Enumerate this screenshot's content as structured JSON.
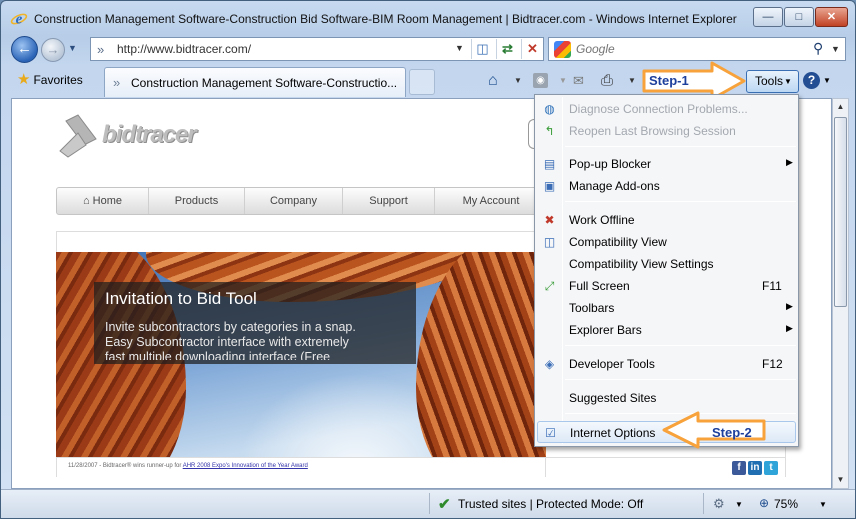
{
  "window": {
    "title": "Construction Management Software-Construction Bid Software-BIM Room Management | Bidtracer.com - Windows Internet Explorer",
    "min_glyph": "—",
    "max_glyph": "□",
    "close_glyph": "✕"
  },
  "address": {
    "url": "http://www.bidtracer.com/"
  },
  "search": {
    "placeholder": "Google"
  },
  "toolbar": {
    "favorites_label": "Favorites",
    "tab_title": "Construction Management Software-Constructio...",
    "tools_label": "Tools",
    "help_glyph": "?"
  },
  "annotations": {
    "step1": "Step-1",
    "step2": "Step-2",
    "arrow_color": "#f7a23b"
  },
  "site": {
    "logo_text": "bidtracer",
    "nav": [
      "Home",
      "Products",
      "Company",
      "Support",
      "My Account"
    ],
    "hero": {
      "title": "Invitation to Bid Tool",
      "text": "Invite subcontractors by categories in a snap.\nEasy Subcontractor interface with extremely\nfast multiple downloading interface (Free"
    },
    "footer": {
      "text": "11/28/2007 - Bidtracer® wins runner-up for ",
      "link": "AHR 2008 Expo's Innovation of the Year Award"
    }
  },
  "tools_menu": {
    "items": [
      {
        "label": "Diagnose Connection Problems...",
        "icon": "diagnose-icon",
        "disabled": true
      },
      {
        "label": "Reopen Last Browsing Session",
        "icon": "reopen-icon",
        "disabled": true
      },
      {
        "label": "Pop-up Blocker",
        "icon": "popup-blocker-icon",
        "submenu": true
      },
      {
        "label": "Manage Add-ons",
        "icon": "addons-icon"
      },
      {
        "label": "Work Offline",
        "icon": "offline-icon"
      },
      {
        "label": "Compatibility View",
        "icon": "compatibility-icon"
      },
      {
        "label": "Compatibility View Settings"
      },
      {
        "label": "Full Screen",
        "icon": "fullscreen-icon",
        "shortcut": "F11"
      },
      {
        "label": "Toolbars",
        "submenu": true
      },
      {
        "label": "Explorer Bars",
        "submenu": true
      },
      {
        "label": "Developer Tools",
        "icon": "developer-tools-icon",
        "shortcut": "F12"
      },
      {
        "label": "Suggested Sites"
      },
      {
        "label": "Internet Options",
        "icon": "internet-options-icon",
        "highlighted": true
      }
    ]
  },
  "status": {
    "zone": "Trusted sites | Protected Mode: Off",
    "zoom": "75%"
  }
}
